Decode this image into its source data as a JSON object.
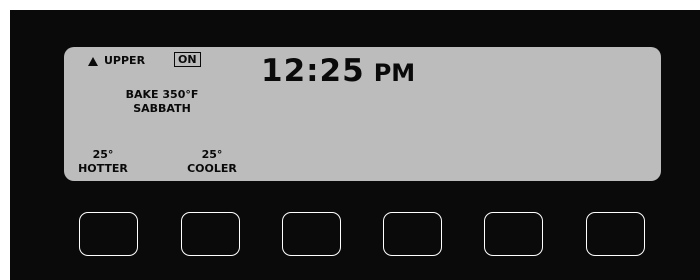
{
  "display": {
    "oven": "UPPER",
    "status_badge": "ON",
    "clock": {
      "time": "12:25",
      "period": "PM"
    },
    "mode_line1": "BAKE 350°F",
    "mode_line2": "SABBATH"
  },
  "soft_labels": [
    {
      "line1": "25°",
      "line2": "HOTTER"
    },
    {
      "line1": "25°",
      "line2": "COOLER"
    }
  ],
  "buttons": [
    "",
    "",
    "",
    "",
    "",
    ""
  ],
  "colors": {
    "panel": "#0a0a0a",
    "lcd": "#bcbcbc",
    "text": "#0a0a0a",
    "button_outline": "#ffffff"
  },
  "icons": {
    "oven_indicator": "triangle-up-icon"
  }
}
